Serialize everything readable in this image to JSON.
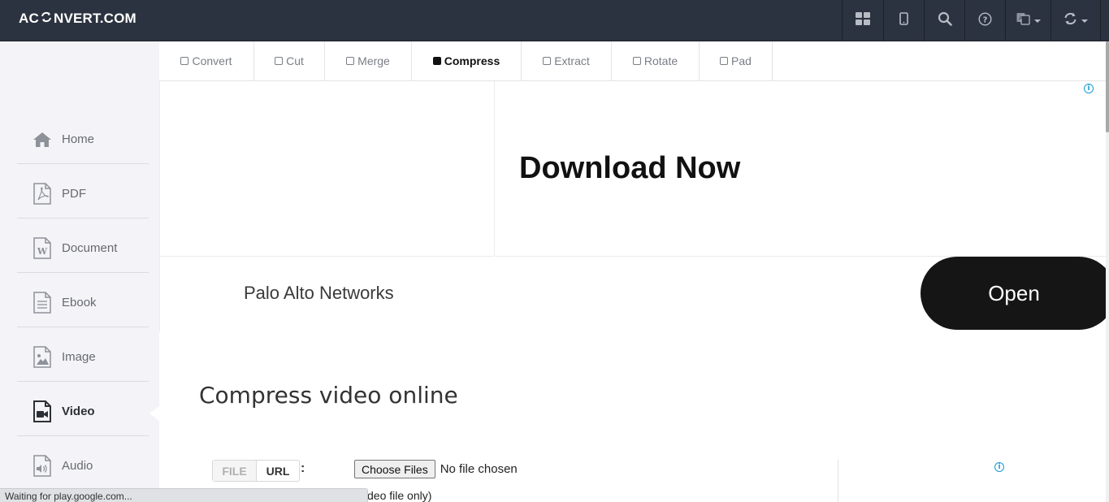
{
  "header": {
    "logo_prefix": "AC",
    "logo_suffix": "NVERT.COM",
    "icons": [
      "grid-icon",
      "mobile-icon",
      "search-icon",
      "help-icon",
      "language-icon",
      "refresh-icon"
    ]
  },
  "sidebar": {
    "items": [
      {
        "label": "Home",
        "icon": "home-icon"
      },
      {
        "label": "PDF",
        "icon": "pdf-file-icon"
      },
      {
        "label": "Document",
        "icon": "word-document-icon"
      },
      {
        "label": "Ebook",
        "icon": "ebook-file-icon"
      },
      {
        "label": "Image",
        "icon": "image-file-icon"
      },
      {
        "label": "Video",
        "icon": "video-file-icon",
        "active": true
      },
      {
        "label": "Audio",
        "icon": "audio-file-icon"
      }
    ]
  },
  "tabs": [
    {
      "label": "Convert"
    },
    {
      "label": "Cut"
    },
    {
      "label": "Merge"
    },
    {
      "label": "Compress",
      "active": true
    },
    {
      "label": "Extract"
    },
    {
      "label": "Rotate"
    },
    {
      "label": "Pad"
    }
  ],
  "ad": {
    "headline": "Download Now",
    "advertiser": "Palo Alto Networks",
    "cta": "Open",
    "info_glyph": "i"
  },
  "main": {
    "title": "Compress video online",
    "source_file": "FILE",
    "source_url": "URL",
    "colon": ":",
    "choose_button": "Choose Files",
    "no_file": "No file chosen",
    "hint": "deo file only)"
  },
  "status": {
    "text": "Waiting for play.google.com..."
  },
  "colors": {
    "navbar": "#2c3340",
    "sidebar": "#f4f3f7",
    "ad_info": "#1a9ad6",
    "cta_bg": "#151515"
  }
}
